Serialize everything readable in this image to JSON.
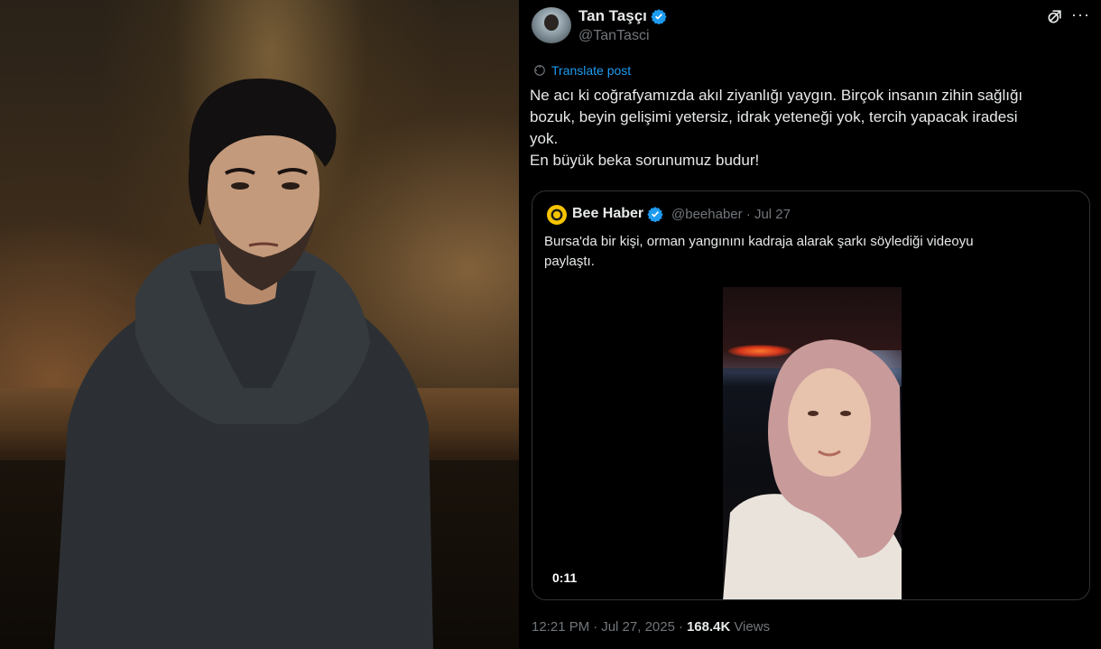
{
  "tweet": {
    "author_name": "Tan Taşçı",
    "author_handle": "@TanTasci",
    "translate_label": "Translate post",
    "text_lines": [
      "Ne acı ki coğrafyamızda akıl ziyanlığı yaygın. Birçok insanın zihin sağlığı",
      "bozuk, beyin gelişimi yetersiz, idrak yeteneği yok, tercih yapacak iradesi",
      "yok.",
      "En büyük beka sorunumuz budur!"
    ],
    "time": "12:21 PM",
    "separator": "·",
    "date": "Jul 27, 2025",
    "views_count": "168.4K",
    "views_label": "Views",
    "more_label": "···"
  },
  "quote": {
    "author_name": "Bee Haber",
    "author_handle": "@beehaber · Jul 27",
    "text_lines": [
      "Bursa'da bir kişi, orman yangınını kadraja alarak şarkı söylediği videoyu",
      "paylaştı."
    ],
    "video_duration": "0:11"
  },
  "colors": {
    "background": "#000000",
    "text_primary": "#e7e9ea",
    "text_secondary": "#71767b",
    "accent": "#1d9bf0",
    "border": "#2f3336",
    "bee_logo": "#f5c400"
  },
  "icons": {
    "verified": "verified-badge-icon",
    "grok": "grok-icon",
    "more": "more-icon",
    "translate": "translate-icon"
  }
}
